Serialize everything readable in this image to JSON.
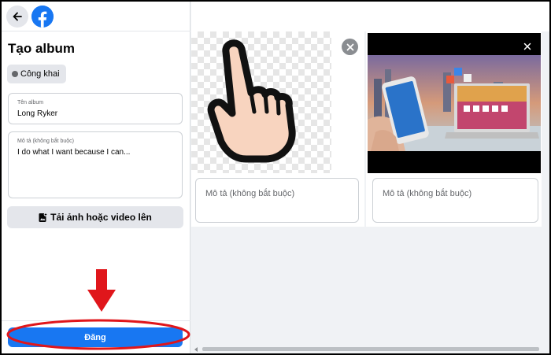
{
  "form": {
    "title": "Tạo album",
    "privacy_label": "Công khai",
    "name_label": "Tên album",
    "name_value": "Long Ryker",
    "desc_label": "Mô tả (không bắt buộc)",
    "desc_value": "I do what I want because I can...",
    "upload_label": "Tải ảnh hoặc video lên",
    "post_label": "Đăng"
  },
  "photos": [
    {
      "caption_placeholder": "Mô tả (không bắt buộc)",
      "close_icon": "close-icon"
    },
    {
      "caption_placeholder": "Mô tả (không bắt buộc)",
      "close_icon": "close-icon"
    }
  ],
  "colors": {
    "accent": "#1877f2",
    "annotation": "#e0161b"
  },
  "icons": [
    "back-arrow-icon",
    "facebook-logo-icon",
    "globe-icon",
    "upload-photo-icon",
    "close-icon",
    "pointing-hand-icon"
  ]
}
